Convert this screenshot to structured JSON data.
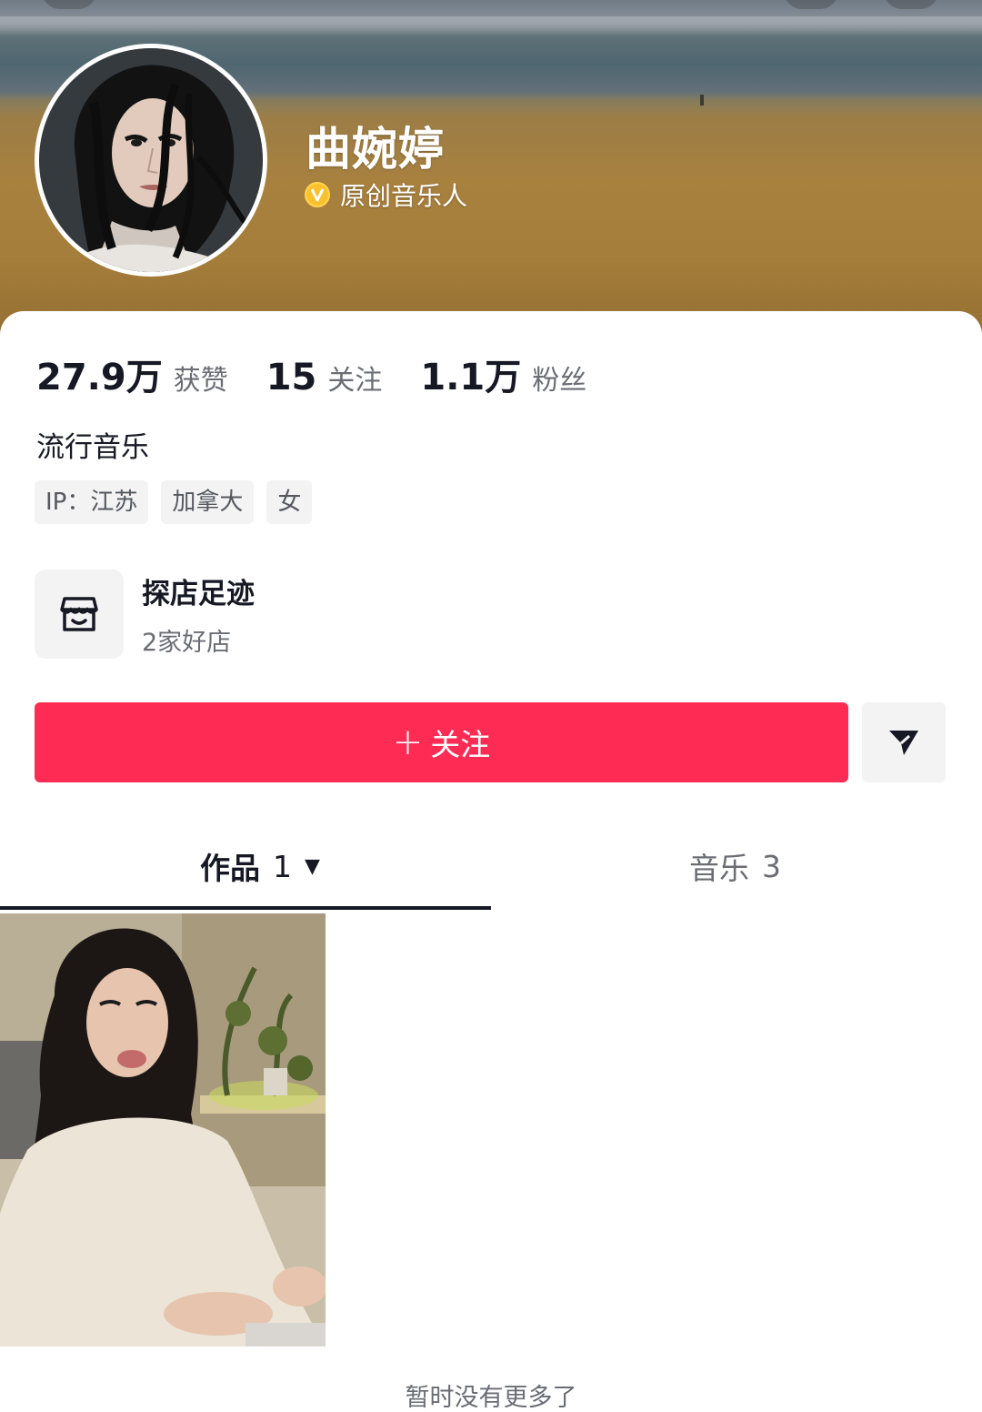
{
  "profile": {
    "name": "曲婉婷",
    "verified_icon": "verified-v-badge",
    "verified_label": "原创音乐人",
    "bio": "流行音乐"
  },
  "stats": [
    {
      "value": "27.9万",
      "label": "获赞"
    },
    {
      "value": "15",
      "label": "关注"
    },
    {
      "value": "1.1万",
      "label": "粉丝"
    }
  ],
  "tags": [
    "IP：江苏",
    "加拿大",
    "女"
  ],
  "store": {
    "icon": "storefront-icon",
    "title": "探店足迹",
    "subtitle": "2家好店"
  },
  "actions": {
    "follow_plus": "+",
    "follow_label": "关注",
    "share_icon": "paper-plane-icon"
  },
  "tabs": {
    "works_label": "作品",
    "works_count": "1",
    "works_caret": "▼",
    "music_label": "音乐",
    "music_count": "3"
  },
  "footer": {
    "no_more": "暂时没有更多了"
  },
  "colors": {
    "accent": "#fe2c55",
    "verified": "#f5b400",
    "text_primary": "#161823",
    "text_secondary": "#6b6d74"
  }
}
